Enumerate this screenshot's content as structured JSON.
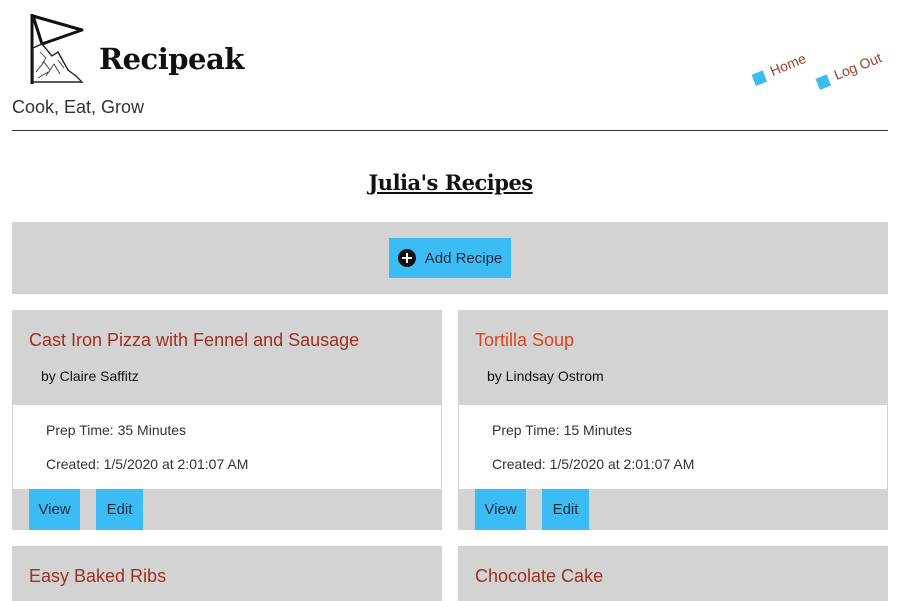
{
  "header": {
    "brand_name": "Recipeak",
    "tagline": "Cook, Eat, Grow",
    "logo_icon": "flag-mountain-icon"
  },
  "nav": {
    "home": "Home",
    "logout": "Log Out"
  },
  "page": {
    "title": "Julia's Recipes"
  },
  "actions": {
    "add_recipe": "Add Recipe"
  },
  "recipes": [
    {
      "title": "Cast Iron Pizza with Fennel and Sausage",
      "author": "by Claire Saffitz",
      "prep": "Prep Time: 35 Minutes",
      "created": "Created: 1/5/2020 at 2:01:07 AM",
      "view": "View",
      "edit": "Edit"
    },
    {
      "title": "Tortilla Soup",
      "author": "by Lindsay Ostrom",
      "prep": "Prep Time: 15 Minutes",
      "created": "Created: 1/5/2020 at 2:01:07 AM",
      "view": "View",
      "edit": "Edit"
    },
    {
      "title": "Easy Baked Ribs"
    },
    {
      "title": "Chocolate Cake"
    }
  ],
  "colors": {
    "accent": "#3bbcf5",
    "card_bg": "#d3d3d3",
    "title_red": "#a0301f",
    "title_orange": "#e0441c"
  }
}
